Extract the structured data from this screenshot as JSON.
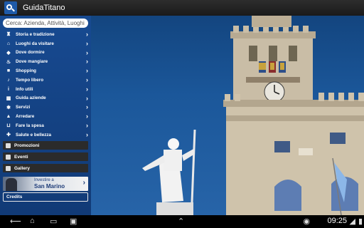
{
  "app": {
    "title": "GuidaTitano"
  },
  "search": {
    "placeholder": "Cerca: Azienda, Attività, Luoghi"
  },
  "menu": [
    {
      "label": "Storia e tradizione",
      "icon": "tower-icon"
    },
    {
      "label": "Luoghi da visitare",
      "icon": "monument-icon"
    },
    {
      "label": "Dove dormire",
      "icon": "tag-icon"
    },
    {
      "label": "Dove mangiare",
      "icon": "dining-icon"
    },
    {
      "label": "Shopping",
      "icon": "shopping-bag-icon"
    },
    {
      "label": "Tempo libero",
      "icon": "leisure-icon"
    },
    {
      "label": "Info utili",
      "icon": "info-icon"
    },
    {
      "label": "Guida aziende",
      "icon": "building-icon"
    },
    {
      "label": "Servizi",
      "icon": "gear-icon"
    },
    {
      "label": "Arredare",
      "icon": "lamp-icon"
    },
    {
      "label": "Fare la spesa",
      "icon": "cart-icon"
    },
    {
      "label": "Salute e bellezza",
      "icon": "health-icon"
    }
  ],
  "sections": [
    {
      "label": "Promozioni"
    },
    {
      "label": "Eventi"
    },
    {
      "label": "Gallery"
    }
  ],
  "banner": {
    "line1": "Investire a",
    "line2": "San Marino"
  },
  "credits": {
    "label": "Credits"
  },
  "system": {
    "time": "09:25"
  }
}
